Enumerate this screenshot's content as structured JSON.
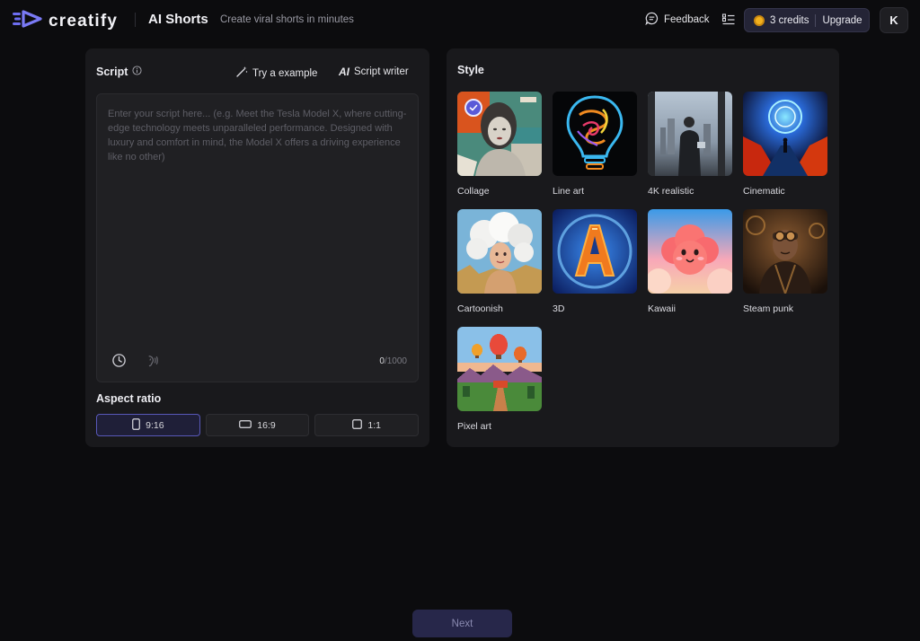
{
  "brand": {
    "name": "creatify",
    "accent": "#5b5bd6"
  },
  "header": {
    "title": "AI Shorts",
    "subtitle": "Create viral shorts in minutes",
    "feedback_label": "Feedback",
    "credits_label": "3 credits",
    "upgrade_label": "Upgrade",
    "avatar_initial": "K"
  },
  "script": {
    "label": "Script",
    "try_example_label": "Try a example",
    "script_writer_label": "Script writer",
    "script_writer_mark": "AI",
    "placeholder": "Enter your script here... (e.g. Meet the Tesla Model X, where cutting-edge technology meets unparalleled performance. Designed with luxury and comfort in mind, the Model X offers a driving experience like no other)",
    "value": "",
    "char_count": "0",
    "char_limit": "/1000"
  },
  "aspect": {
    "label": "Aspect ratio",
    "options": [
      {
        "label": "9:16",
        "selected": true
      },
      {
        "label": "16:9",
        "selected": false
      },
      {
        "label": "1:1",
        "selected": false
      }
    ]
  },
  "style": {
    "label": "Style",
    "selected": "Collage",
    "items": [
      {
        "name": "Collage"
      },
      {
        "name": "Line art"
      },
      {
        "name": "4K realistic"
      },
      {
        "name": "Cinematic"
      },
      {
        "name": "Cartoonish"
      },
      {
        "name": "3D"
      },
      {
        "name": "Kawaii"
      },
      {
        "name": "Steam punk"
      },
      {
        "name": "Pixel art"
      }
    ]
  },
  "footer": {
    "next_label": "Next"
  }
}
